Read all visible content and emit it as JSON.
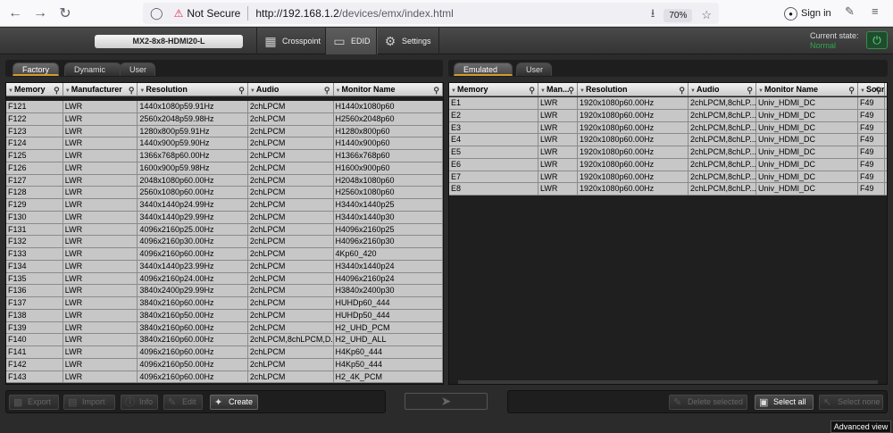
{
  "browser": {
    "not_secure": "Not Secure",
    "url_host": "http://192.168.1.2",
    "url_path": "/devices/emx/index.html",
    "zoom": "70%",
    "sign_in": "Sign in"
  },
  "app": {
    "device_name": "MX2-8x8-HDMI20-L",
    "tabs": [
      {
        "label": "Crosspoint",
        "icon": "grid-icon"
      },
      {
        "label": "EDID",
        "icon": "monitor-icon"
      },
      {
        "label": "Settings",
        "icon": "gear-icon"
      }
    ],
    "current_state_label": "Current state:",
    "current_state_value": "Normal"
  },
  "left": {
    "tabs": [
      "Factory",
      "Dynamic",
      "User"
    ],
    "headers": [
      "Memory",
      "Manufacturer",
      "Resolution",
      "Audio",
      "Monitor Name"
    ],
    "rows": [
      [
        "F121",
        "LWR",
        "1440x1080p59.91Hz",
        "2chLPCM",
        "H1440x1080p60"
      ],
      [
        "F122",
        "LWR",
        "2560x2048p59.98Hz",
        "2chLPCM",
        "H2560x2048p60"
      ],
      [
        "F123",
        "LWR",
        "1280x800p59.91Hz",
        "2chLPCM",
        "H1280x800p60"
      ],
      [
        "F124",
        "LWR",
        "1440x900p59.90Hz",
        "2chLPCM",
        "H1440x900p60"
      ],
      [
        "F125",
        "LWR",
        "1366x768p60.00Hz",
        "2chLPCM",
        "H1366x768p60"
      ],
      [
        "F126",
        "LWR",
        "1600x900p59.98Hz",
        "2chLPCM",
        "H1600x900p60"
      ],
      [
        "F127",
        "LWR",
        "2048x1080p60.00Hz",
        "2chLPCM",
        "H2048x1080p60"
      ],
      [
        "F128",
        "LWR",
        "2560x1080p60.00Hz",
        "2chLPCM",
        "H2560x1080p60"
      ],
      [
        "F129",
        "LWR",
        "3440x1440p24.99Hz",
        "2chLPCM",
        "H3440x1440p25"
      ],
      [
        "F130",
        "LWR",
        "3440x1440p29.99Hz",
        "2chLPCM",
        "H3440x1440p30"
      ],
      [
        "F131",
        "LWR",
        "4096x2160p25.00Hz",
        "2chLPCM",
        "H4096x2160p25"
      ],
      [
        "F132",
        "LWR",
        "4096x2160p30.00Hz",
        "2chLPCM",
        "H4096x2160p30"
      ],
      [
        "F133",
        "LWR",
        "4096x2160p60.00Hz",
        "2chLPCM",
        "4Kp60_420"
      ],
      [
        "F134",
        "LWR",
        "3440x1440p23.99Hz",
        "2chLPCM",
        "H3440x1440p24"
      ],
      [
        "F135",
        "LWR",
        "4096x2160p24.00Hz",
        "2chLPCM",
        "H4096x2160p24"
      ],
      [
        "F136",
        "LWR",
        "3840x2400p29.99Hz",
        "2chLPCM",
        "H3840x2400p30"
      ],
      [
        "F137",
        "LWR",
        "3840x2160p60.00Hz",
        "2chLPCM",
        "HUHDp60_444"
      ],
      [
        "F138",
        "LWR",
        "3840x2160p50.00Hz",
        "2chLPCM",
        "HUHDp50_444"
      ],
      [
        "F139",
        "LWR",
        "3840x2160p60.00Hz",
        "2chLPCM",
        "H2_UHD_PCM"
      ],
      [
        "F140",
        "LWR",
        "3840x2160p60.00Hz",
        "2chLPCM,8chLPCM,D...",
        "H2_UHD_ALL"
      ],
      [
        "F141",
        "LWR",
        "4096x2160p60.00Hz",
        "2chLPCM",
        "H4Kp60_444"
      ],
      [
        "F142",
        "LWR",
        "4096x2160p50.00Hz",
        "2chLPCM",
        "H4Kp50_444"
      ],
      [
        "F143",
        "LWR",
        "4096x2160p60.00Hz",
        "2chLPCM",
        "H2_4K_PCM"
      ]
    ],
    "buttons": [
      {
        "label": "Export",
        "icon": "save-icon"
      },
      {
        "label": "Import",
        "icon": "folder-icon"
      },
      {
        "label": "Info",
        "icon": "info-icon"
      },
      {
        "label": "Edit",
        "icon": "edit-icon"
      },
      {
        "label": "Create",
        "icon": "wrench-icon"
      }
    ]
  },
  "right": {
    "tabs": [
      "Emulated",
      "User"
    ],
    "headers": [
      "Memory",
      "Man...",
      "Resolution",
      "Audio",
      "Monitor Name",
      "Sour..."
    ],
    "rows": [
      [
        "E1",
        "LWR",
        "1920x1080p60.00Hz",
        "2chLPCM,8chLP...",
        "Univ_HDMI_DC",
        "F49"
      ],
      [
        "E2",
        "LWR",
        "1920x1080p60.00Hz",
        "2chLPCM,8chLP...",
        "Univ_HDMI_DC",
        "F49"
      ],
      [
        "E3",
        "LWR",
        "1920x1080p60.00Hz",
        "2chLPCM,8chLP...",
        "Univ_HDMI_DC",
        "F49"
      ],
      [
        "E4",
        "LWR",
        "1920x1080p60.00Hz",
        "2chLPCM,8chLP...",
        "Univ_HDMI_DC",
        "F49"
      ],
      [
        "E5",
        "LWR",
        "1920x1080p60.00Hz",
        "2chLPCM,8chLP...",
        "Univ_HDMI_DC",
        "F49"
      ],
      [
        "E6",
        "LWR",
        "1920x1080p60.00Hz",
        "2chLPCM,8chLP...",
        "Univ_HDMI_DC",
        "F49"
      ],
      [
        "E7",
        "LWR",
        "1920x1080p60.00Hz",
        "2chLPCM,8chLP...",
        "Univ_HDMI_DC",
        "F49"
      ],
      [
        "E8",
        "LWR",
        "1920x1080p60.00Hz",
        "2chLPCM,8chLP...",
        "Univ_HDMI_DC",
        "F49"
      ]
    ],
    "buttons": [
      {
        "label": "Delete selected",
        "icon": "edit-icon"
      },
      {
        "label": "Select all",
        "icon": "select-all-icon"
      },
      {
        "label": "Select none",
        "icon": "cursor-icon"
      }
    ]
  },
  "footer": {
    "advanced_view": "Advanced view"
  }
}
